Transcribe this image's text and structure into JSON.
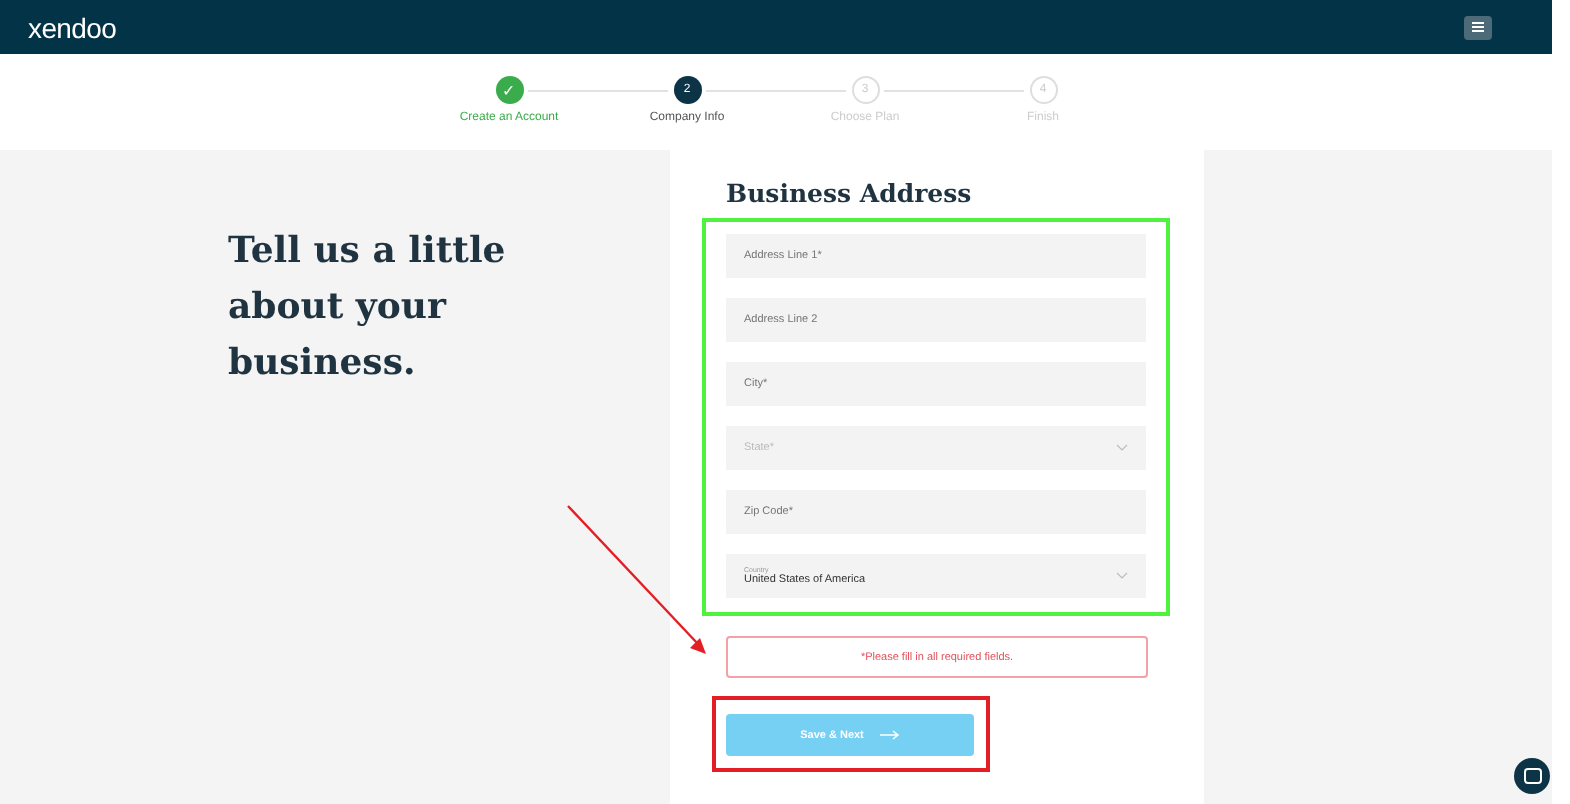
{
  "header": {
    "logo": "xendoo"
  },
  "steps": [
    {
      "number": "✓",
      "label": "Create an Account",
      "completed": true,
      "selected": false
    },
    {
      "number": "2",
      "label": "Company Info",
      "completed": false,
      "selected": true
    },
    {
      "number": "3",
      "label": "Choose Plan",
      "completed": false,
      "selected": false
    },
    {
      "number": "4",
      "label": "Finish",
      "completed": false,
      "selected": false
    }
  ],
  "intro": "Tell us a little about your business.",
  "form": {
    "title": "Business Address",
    "fields": [
      {
        "kind": "text",
        "placeholder": "Address Line 1*"
      },
      {
        "kind": "text",
        "placeholder": "Address Line 2"
      },
      {
        "kind": "text",
        "placeholder": "City*"
      },
      {
        "kind": "select",
        "placeholder": "State*"
      },
      {
        "kind": "text",
        "placeholder": "Zip Code*"
      },
      {
        "kind": "select",
        "label": "Country",
        "value": "United States of America"
      }
    ],
    "error": "*Please fill in all required fields.",
    "button": "Save & Next"
  }
}
